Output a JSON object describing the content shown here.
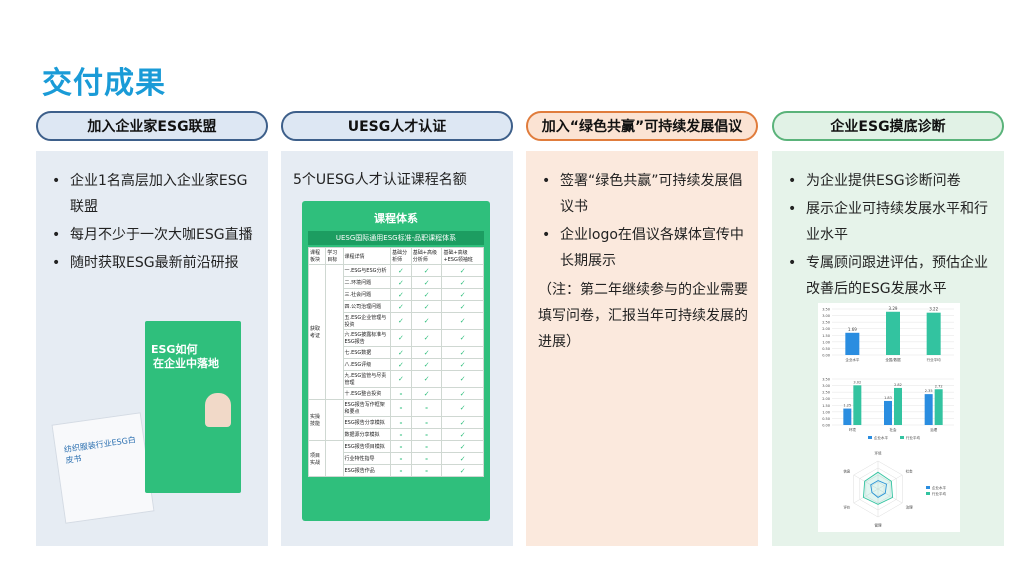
{
  "page": {
    "title": "交付成果"
  },
  "columns": [
    {
      "header": "加入企业家ESG联盟",
      "bullets": [
        "企业1名高层加入企业家ESG联盟",
        "每月不少于一次大咖ESG直播",
        "随时获取ESG最新前沿研报"
      ],
      "poster": {
        "line1": "ESG如何",
        "line2": "在企业中落地",
        "booklet_title": "纺织服装行业ESG白皮书"
      }
    },
    {
      "header": "UESG人才认证",
      "text": "5个UESG人才认证课程名额",
      "course": {
        "title": "课程体系",
        "subtitle": "UESG国际通用ESG标准-品职课程体系",
        "col_headers": [
          "课程板块",
          "学习目标",
          "课程详情",
          "基础分析师",
          "基础+高级分析师",
          "基础+高级+ESG领袖班"
        ],
        "sections": [
          "获取考证",
          "实操技能",
          "项目实战"
        ],
        "items": [
          "一.ESG与ESG分析",
          "二.环境问题",
          "三.社会问题",
          "四.公司治理问题",
          "五.ESG企业管理与投资",
          "六.ESG披露标准与ESG报告",
          "七.ESG数据",
          "八.ESG评级",
          "九.ESG监管与尽责管理",
          "十.ESG整合投资",
          "ESG报告写作框架和要点",
          "ESG报告分享模拟",
          "数据源分享模拟",
          "ESG报告项目模拟",
          "行业特性指导",
          "ESG报告作品"
        ]
      }
    },
    {
      "header": "加入“绿色共赢”可持续发展倡议",
      "bullets": [
        "签署“绿色共赢”可持续发展倡议书",
        "企业logo在倡议各媒体宣传中长期展示"
      ],
      "note": "（注：第二年继续参与的企业需要填写问卷，汇报当年可持续发展的进展）"
    },
    {
      "header": "企业ESG摸底诊断",
      "bullets": [
        "为企业提供ESG诊断问卷",
        "展示企业可持续发展水平和行业水平",
        "专属顾问跟进评估，预估企业改善后的ESG发展水平"
      ]
    }
  ],
  "chart_data": [
    {
      "type": "bar",
      "categories": [
        "企业水平",
        "全国/数据",
        "行业平均"
      ],
      "values": [
        1.69,
        3.29,
        3.22
      ],
      "ylim": [
        0,
        3.5
      ]
    },
    {
      "type": "bar",
      "categories": [
        "环境",
        "社会",
        "治理"
      ],
      "series": [
        {
          "name": "企业水平",
          "values": [
            1.25,
            1.83,
            2.35
          ]
        },
        {
          "name": "行业平均",
          "values": [
            3.02,
            2.82,
            2.72
          ]
        }
      ],
      "ylim": [
        0,
        3.5
      ]
    },
    {
      "type": "radar",
      "categories": [
        "环境",
        "社会",
        "治理",
        "管理",
        "评价",
        "信息"
      ],
      "series": [
        {
          "name": "企业水平",
          "values": [
            0.3,
            0.35,
            0.3,
            0.3,
            0.25,
            0.3
          ]
        },
        {
          "name": "行业平均",
          "values": [
            0.6,
            0.55,
            0.6,
            0.55,
            0.6,
            0.55
          ]
        }
      ]
    }
  ],
  "colors": {
    "accent": "#1a9bd7",
    "bar_blue": "#2a8de0",
    "bar_green": "#33c3a0"
  }
}
